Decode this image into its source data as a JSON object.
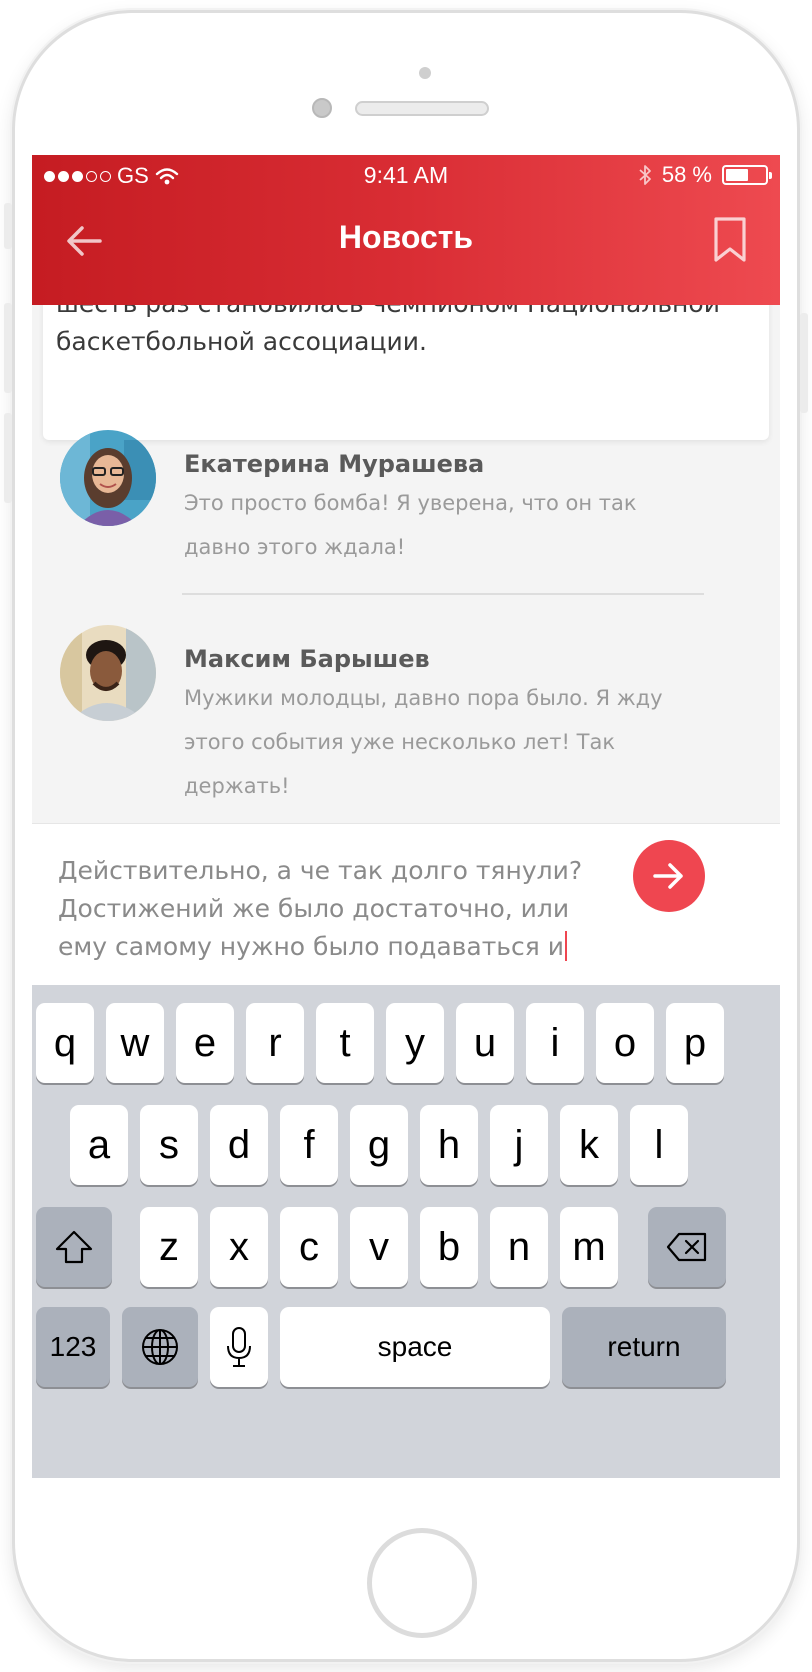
{
  "status_bar": {
    "carrier": "GS",
    "time": "9:41 AM",
    "battery": "58 %",
    "battery_level": 0.58,
    "signal_bars_filled": 3,
    "signal_bars_total": 5
  },
  "nav": {
    "title": "Новость",
    "back_icon": "arrow-left-icon",
    "bookmark_icon": "bookmark-icon"
  },
  "article": {
    "text": "шесть раз становилась чемпионом Национальной баскетбольной ассоциации."
  },
  "comments": [
    {
      "author": "Екатерина Мурашева",
      "text": "Это просто бомба! Я уверена, что он так давно этого ждала!"
    },
    {
      "author": "Максим Барышев",
      "text": "Мужики молодцы, давно пора было. Я жду этого события уже несколько лет! Так держать!"
    }
  ],
  "composer": {
    "text": "Действительно, а че так долго тянули? Достижений же было достаточно, или ему самому нужно было подаваться и",
    "send_icon": "arrow-right-icon"
  },
  "keyboard": {
    "row1": [
      "q",
      "w",
      "e",
      "r",
      "t",
      "y",
      "u",
      "i",
      "o",
      "p"
    ],
    "row2": [
      "a",
      "s",
      "d",
      "f",
      "g",
      "h",
      "j",
      "k",
      "l"
    ],
    "row3": [
      "z",
      "x",
      "c",
      "v",
      "b",
      "n",
      "m"
    ],
    "numbers_label": "123",
    "space_label": "space",
    "return_label": "return"
  },
  "colors": {
    "accent": "#ef4650",
    "header_start": "#c51c22",
    "header_end": "#ee4a50"
  }
}
